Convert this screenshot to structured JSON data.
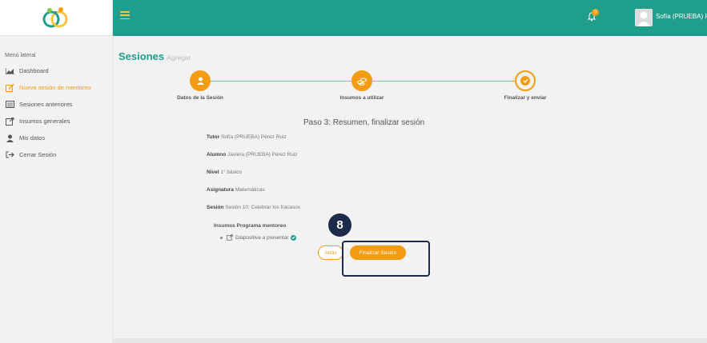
{
  "sidebar": {
    "menu_title": "Menú lateral",
    "items": [
      {
        "label": "Dashboard",
        "icon": "chart-icon",
        "active": false
      },
      {
        "label": "Nueva sesión de mentoreo",
        "icon": "edit-icon",
        "active": true
      },
      {
        "label": "Sesiones anteriores",
        "icon": "list-icon",
        "active": false
      },
      {
        "label": "Insumos generales",
        "icon": "external-link-icon",
        "active": false
      },
      {
        "label": "Mis datos",
        "icon": "user-icon",
        "active": false
      },
      {
        "label": "Cerrar Sesión",
        "icon": "sign-out-icon",
        "active": false
      }
    ]
  },
  "topbar": {
    "notification_count": "0",
    "user_name": "Sofía (PRUEBA) Pérez ⌄"
  },
  "header": {
    "title": "Sesiones",
    "subtitle": "Agregar"
  },
  "steps": [
    {
      "label": "Datos de la Sesión",
      "state": "done"
    },
    {
      "label": "Insumos a utilizar",
      "state": "done"
    },
    {
      "label": "Finalizar y enviar",
      "state": "current"
    }
  ],
  "summary": {
    "heading": "Paso 3: Resumen, finalizar sesión",
    "fields": [
      {
        "label": "Tutor",
        "value": "Sofía (PRUEBA) Pérez Ruiz"
      },
      {
        "label": "Alumno",
        "value": "Javiera (PRUEBA) Pérez Ruiz"
      },
      {
        "label": "Nivel",
        "value": "1° básico"
      },
      {
        "label": "Asignatura",
        "value": "Matemáticas"
      },
      {
        "label": "Sesión",
        "value": "Sesión 10: Celebrar los fracasos"
      }
    ],
    "insumos_title": "Insumos Programa mentoreo",
    "insumos": [
      "Diapositiva a presentar"
    ]
  },
  "buttons": {
    "back": "Atrás",
    "finish": "Finalizar Sesión"
  },
  "annotation": {
    "step_number": "8"
  },
  "colors": {
    "brand": "#1f9f8b",
    "accent": "#f39c12",
    "highlight": "#1c2b4a"
  }
}
